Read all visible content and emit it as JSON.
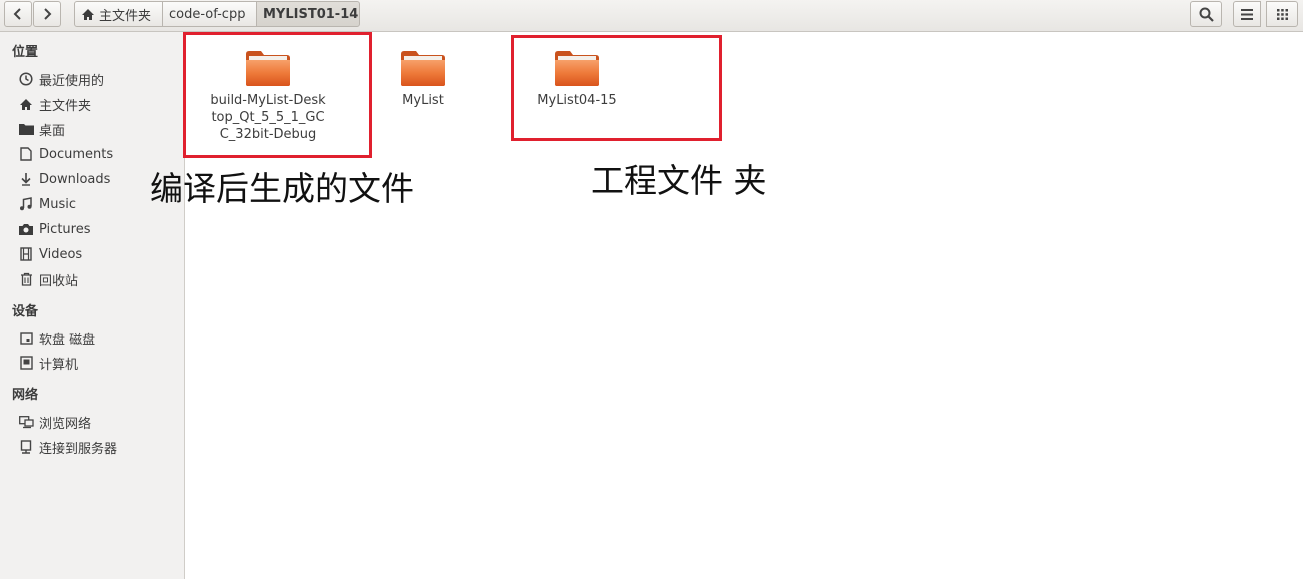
{
  "toolbar": {
    "back_icon": "chevron-left",
    "forward_icon": "chevron-right",
    "breadcrumbs": [
      {
        "label": "主文件夹",
        "icon": "home-icon"
      },
      {
        "label": "code-of-cpp"
      },
      {
        "label": "MYLIST01-14",
        "active": true
      }
    ],
    "search_icon": "search-icon",
    "menu_icon": "list-menu-icon",
    "view_icon": "grid-view-icon"
  },
  "sidebar": {
    "places_title": "位置",
    "places": [
      {
        "label": "最近使用的",
        "icon": "clock-icon"
      },
      {
        "label": "主文件夹",
        "icon": "home-icon"
      },
      {
        "label": "桌面",
        "icon": "folder-icon"
      },
      {
        "label": "Documents",
        "icon": "document-icon"
      },
      {
        "label": "Downloads",
        "icon": "download-icon"
      },
      {
        "label": "Music",
        "icon": "music-icon"
      },
      {
        "label": "Pictures",
        "icon": "camera-icon"
      },
      {
        "label": "Videos",
        "icon": "film-icon"
      },
      {
        "label": "回收站",
        "icon": "trash-icon"
      }
    ],
    "devices_title": "设备",
    "devices": [
      {
        "label": "软盘 磁盘",
        "icon": "disk-icon"
      },
      {
        "label": "计算机",
        "icon": "computer-icon"
      }
    ],
    "network_title": "网络",
    "network": [
      {
        "label": "浏览网络",
        "icon": "network-icon"
      },
      {
        "label": "连接到服务器",
        "icon": "server-icon"
      }
    ]
  },
  "files": [
    {
      "name": "build-MyList-Desktop_Qt_5_5_1_GCC_32bit-Debug"
    },
    {
      "name": "MyList"
    },
    {
      "name": "MyList04-15"
    }
  ],
  "annotations": {
    "left": "编译后生成的文件",
    "right": "工程文件 夹"
  },
  "colors": {
    "highlight_box": "#e0202e",
    "folder_orange": "#e8622a"
  }
}
